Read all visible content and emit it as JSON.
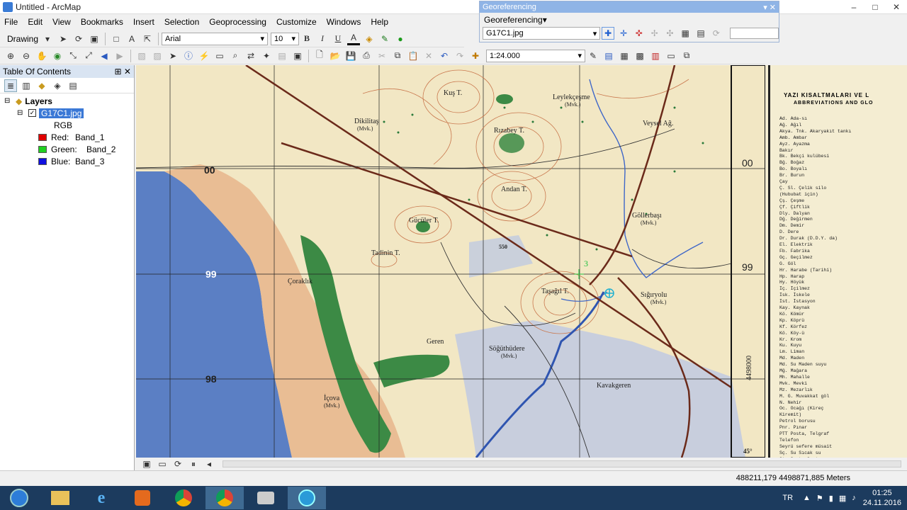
{
  "window": {
    "title": "Untitled - ArcMap",
    "controls": [
      "–",
      "□",
      "✕"
    ]
  },
  "menu": [
    "File",
    "Edit",
    "View",
    "Bookmarks",
    "Insert",
    "Selection",
    "Geoprocessing",
    "Customize",
    "Windows",
    "Help"
  ],
  "drawing_toolbar": {
    "drawing_label": "Drawing",
    "font": "Arial",
    "size": "10",
    "bold": "B",
    "italic": "I",
    "underline": "U",
    "font_color_label": "A"
  },
  "georef": {
    "title": "Georeferencing",
    "menu_label": "Georeferencing",
    "layer": "G17C1.jpg"
  },
  "standard_toolbar": {
    "scale": "1:24.000"
  },
  "toc": {
    "title": "Table Of Contents",
    "root": "Layers",
    "layer": "G17C1.jpg",
    "render": "RGB",
    "bands": [
      {
        "label": "Red:",
        "band": "Band_1",
        "color": "#e00000"
      },
      {
        "label": "Green:",
        "band": "Band_2",
        "color": "#20d020"
      },
      {
        "label": "Blue:",
        "band": "Band_3",
        "color": "#1010e0"
      }
    ]
  },
  "map": {
    "grid_labels": [
      "00",
      "99",
      "98"
    ],
    "right_grid_labels": [
      "00",
      "99"
    ],
    "places": [
      "Kuş T.",
      "Leylekçeşme",
      "(Mvk.)",
      "Dikilitaş",
      "(Mvk.)",
      "Rızabey T.",
      "Veysel Ağ.",
      "Andan T.",
      "Göllerbaşı",
      "(Mvk.)",
      "Gücüler T.",
      "Tadinin T.",
      "Çoraklık",
      "Taşağıl T.",
      "Sığıryolu",
      "(Mvk.)",
      "Geren",
      "Söğüthüdere",
      "(Mvk.)",
      "Kavakgeren",
      "İçova",
      "(Mvk.)"
    ],
    "road_label": "550",
    "point_label": "3",
    "side_label": "4498000",
    "corner_label": "45°"
  },
  "legend": {
    "title1": "YAZI KISALTMALARI VE L",
    "title2": "ABBREVIATIONS AND GLO",
    "lines": [
      "Ad.          Ada-sı",
      "Ağ.          Ağıl",
      "Akya. Tnk.   Akaryakıt tankı",
      "Amb.         Ambar",
      "Ayz.         Ayazma",
      "             Bakır",
      "Bk.          Bekçi kulübesi",
      "Bğ.          Boğaz",
      "Bo.          Boyalı",
      "Br.          Burun",
      "             Çay",
      "Ç. Sl.       Çelik silo",
      "             (Hububat için)",
      "Çş.          Çeşme",
      "Çf.          Çiftlik",
      "Dly.         Dalyan",
      "Dğ.          Değirmen",
      "Dm.          Demir",
      "D.           Dere",
      "Dr.          Durak (D.D.Y. da)",
      "El.          Elektrik",
      "Fb.          Fabrika",
      "Gç.          Geçilmez",
      "G.           Göl",
      "Hr.          Harabe (Tarihi)",
      "Hp.          Harap",
      "Hy.          Höyük",
      "İç.          İçilmez",
      "İsk.         İskele",
      "İst.         İstasyon",
      "Kay.         Kaynak",
      "Kö.          Kömür",
      "Kp.          Köprü",
      "Kf.          Körfez",
      "Kö.          Köy-ü",
      "Kr.          Krom",
      "Ku.          Kuyu",
      "Lm.          Liman",
      "Md.          Maden",
      "Md. Su       Maden suyu",
      "Mğ.          Mağara",
      "Mh.          Mahalle",
      "Mvk.         Mevki",
      "Mz.          Mezarlık",
      "M. G.        Muvakkat göl",
      "N.           Nehir",
      "Oc.          Ocağı (Kireç",
      "             Kiremit)",
      "             Petrol borusu",
      "Pnr.         Pınar",
      "PTT          Posta, Telgraf",
      "             Telefon",
      "             Seyrü sefere müsait",
      "Sç. Su       Sıcak su",
      "St.          Sırt, Sırtı"
    ]
  },
  "status": {
    "coords": "488211,179  4498871,885 Meters"
  },
  "tray": {
    "lang": "TR",
    "time": "01:25",
    "date": "24.11.2016"
  },
  "colors": {
    "water": "#5b7fc4",
    "sand": "#e8b58c",
    "forest": "#3c8a45",
    "paper": "#f2e7c4",
    "rail": "#6b2a1a",
    "taskbar": "#1c3b5e"
  }
}
